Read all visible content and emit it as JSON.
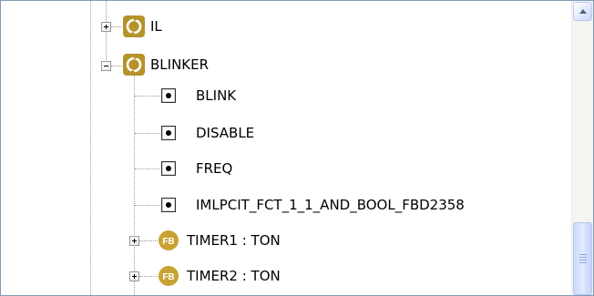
{
  "tree": {
    "nodes": [
      {
        "label": "IL",
        "kind": "program-icon",
        "expander": "plus",
        "level": 1
      },
      {
        "label": "BLINKER",
        "kind": "program-icon",
        "expander": "minus",
        "level": 1
      },
      {
        "label": "BLINK",
        "kind": "variable-icon",
        "level": 2
      },
      {
        "label": "DISABLE",
        "kind": "variable-icon",
        "level": 2
      },
      {
        "label": "FREQ",
        "kind": "variable-icon",
        "level": 2
      },
      {
        "label": "IMLPCIT_FCT_1_1_AND_BOOL_FBD2358",
        "kind": "variable-icon",
        "level": 2
      },
      {
        "label": "TIMER1 : TON",
        "kind": "function-block-icon",
        "expander": "plus",
        "level": 2
      },
      {
        "label": "TIMER2 : TON",
        "kind": "function-block-icon",
        "expander": "plus",
        "level": 2
      }
    ],
    "function_block_badge": "FB"
  },
  "colors": {
    "program_icon": "#b5932a",
    "function_block_icon": "#c9a233",
    "connector": "#9a9a9a"
  }
}
